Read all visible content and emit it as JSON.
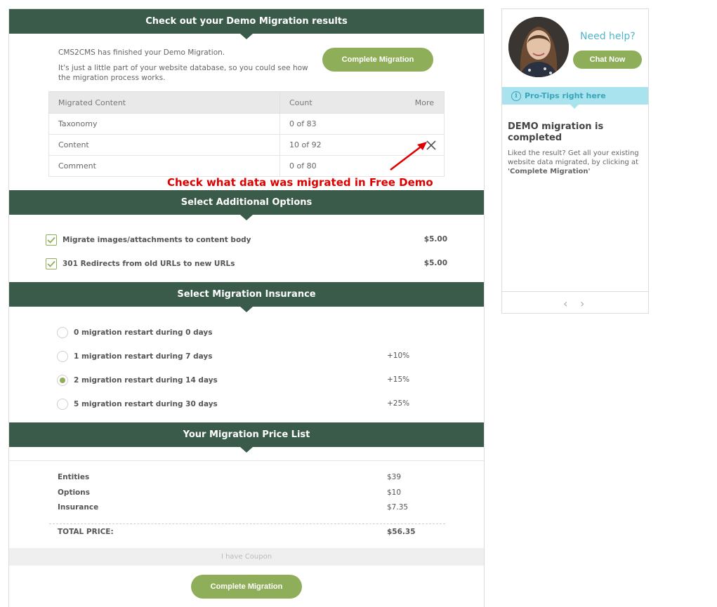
{
  "results": {
    "header": "Check out your Demo Migration results",
    "intro_line1": "CMS2CMS has finished your Demo Migration.",
    "intro_line2a": "It's just a little part of your website database, so you could see how",
    "intro_line2b": "the migration process works.",
    "complete_button": "Complete Migration",
    "table": {
      "columns": [
        "Migrated Content",
        "Count",
        "More"
      ],
      "rows": [
        {
          "content": "Taxonomy",
          "count": "0 of 83"
        },
        {
          "content": "Content",
          "count": "10 of 92"
        },
        {
          "content": "Comment",
          "count": "0 of 80"
        }
      ]
    },
    "annotation": "Check what data was migrated in Free Demo"
  },
  "options": {
    "header": "Select Additional Options",
    "items": [
      {
        "label": "Migrate images/attachments to content body",
        "price": "$5.00",
        "checked": true
      },
      {
        "label": "301 Redirects from old URLs to new URLs",
        "price": "$5.00",
        "checked": true
      }
    ]
  },
  "insurance": {
    "header": "Select Migration Insurance",
    "items": [
      {
        "label": "0 migration restart during 0 days",
        "pct": "",
        "selected": false
      },
      {
        "label": "1 migration restart during 7 days",
        "pct": "+10%",
        "selected": false
      },
      {
        "label": "2 migration restart during 14 days",
        "pct": "+15%",
        "selected": true
      },
      {
        "label": "5 migration restart during 30 days",
        "pct": "+25%",
        "selected": false
      }
    ]
  },
  "price_list": {
    "header": "Your Migration Price List",
    "rows": [
      {
        "label": "Entities",
        "value": "$39"
      },
      {
        "label": "Options",
        "value": "$10"
      },
      {
        "label": "Insurance",
        "value": "$7.35"
      }
    ],
    "total_label": "TOTAL PRICE:",
    "total_value": "$56.35",
    "coupon": "I have Coupon",
    "complete_button": "Complete Migration"
  },
  "sidebar": {
    "need_help": "Need help?",
    "chat_button": "Chat Now",
    "tips_label": "Pro-Tips right here",
    "info_glyph": "i",
    "title": "DEMO migration is completed",
    "desc": "Liked the result? Get all your existing website data migrated, by clicking at",
    "desc_bold": "'Complete Migration'",
    "prev": "‹",
    "next": "›"
  },
  "colors": {
    "band": "#3b5b4a",
    "accent_green": "#8fae5a",
    "help_blue": "#52b6c9",
    "annotation_red": "#e00000"
  }
}
